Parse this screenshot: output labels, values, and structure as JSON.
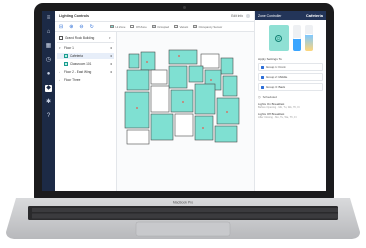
{
  "app": {
    "title": "Lighting Controls",
    "user_label": "Edit Info"
  },
  "left_nav": {
    "icons": [
      "menu-icon",
      "home-icon",
      "building-icon",
      "schedule-icon",
      "user-icon",
      "lightbulb-icon",
      "gear-icon",
      "help-icon"
    ]
  },
  "toolbar": {
    "icons": [
      "collapse-icon",
      "zoom-in-icon",
      "zoom-out-icon",
      "refresh-icon"
    ],
    "legend": [
      {
        "label": "Lit Zone",
        "color": "#7fe0d2"
      },
      {
        "label": "Off Zone",
        "color": "#ffffff"
      },
      {
        "label": "Occupied",
        "color": "#cfd4da"
      },
      {
        "label": "Vacant",
        "color": "#f0f0f0"
      },
      {
        "label": "Occupancy Sensor",
        "color": "#dddddd"
      }
    ]
  },
  "tree": {
    "building": "Grand Rock Building",
    "items": [
      {
        "label": "Floor 1",
        "level": 0
      },
      {
        "label": "Cafeteria",
        "level": 1
      },
      {
        "label": "Classroom 101",
        "level": 1
      },
      {
        "label": "Floor 2 - East Wing",
        "level": 0
      },
      {
        "label": "Floor Three",
        "level": 0
      }
    ]
  },
  "panel": {
    "header": "Zone Controller",
    "zone_name": "Cafeteria",
    "brightness_level": 0.45,
    "temperature_level": 0.6,
    "apply_label": "Apply Settings To",
    "groups": [
      "Group 1: Front",
      "Group 2: Middle",
      "Group 3: Back"
    ],
    "scheduled_label": "Scheduled",
    "events": [
      {
        "title": "Lights On Breakfast",
        "sub": "Before Opening · Mo, Tu, We, Th, Fr"
      },
      {
        "title": "Lights Off Breakfast",
        "sub": "After Closing · Mo, Tu, We, Th, Fr"
      }
    ]
  },
  "base": {
    "model_label": "MacBook Pro"
  },
  "colors": {
    "lit_zone": "#7fe0d2",
    "nav_bg": "#1c2a46",
    "panel_header": "#233559",
    "accent": "#2e6fd8"
  }
}
